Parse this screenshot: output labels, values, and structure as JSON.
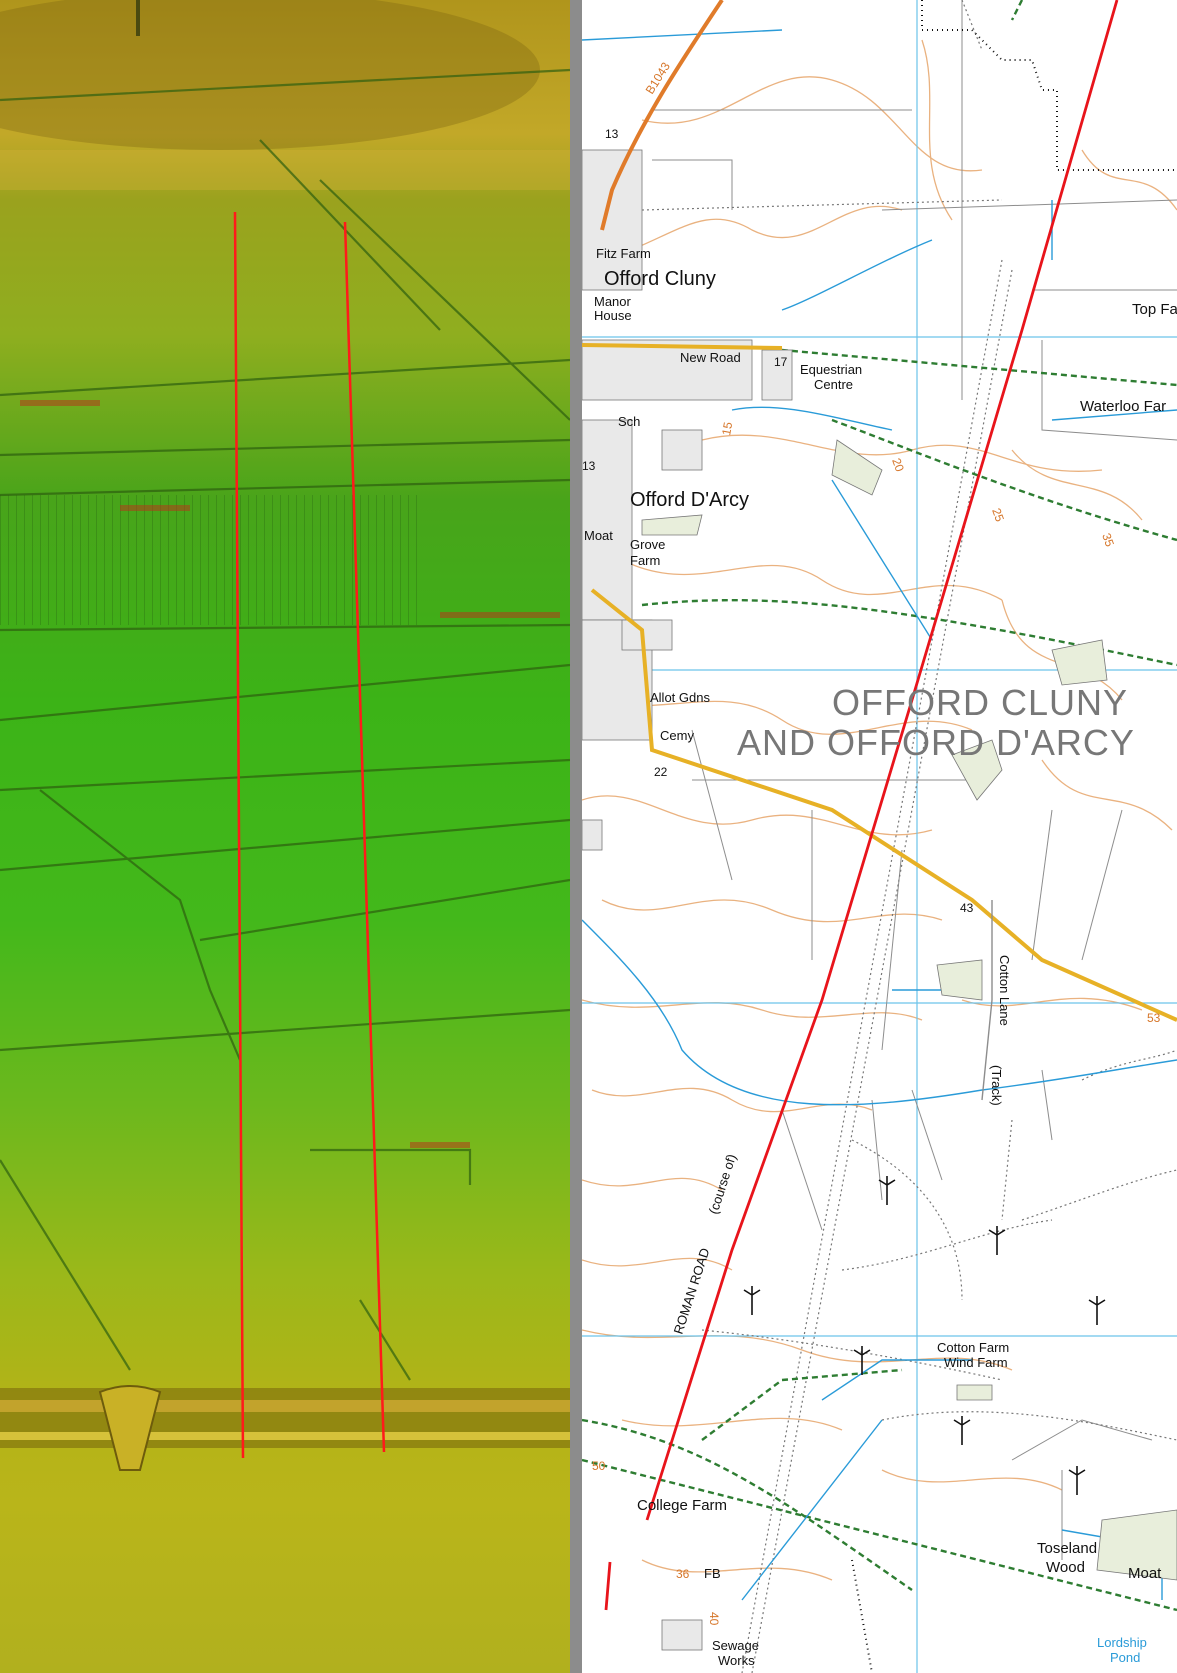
{
  "lidar_panel": {
    "colors": {
      "top": "#b39a1e",
      "mid": "#3fb21c",
      "bottom": "#b9b418",
      "trace": "#ff1a1a"
    }
  },
  "os_map": {
    "colors": {
      "grid": "#6cc3ea",
      "contour": "#e6a56a",
      "road_b": "#e07b2a",
      "road_minor": "#e7b126",
      "footpath": "#2e7d32",
      "field": "#8d8d8d",
      "trace": "#e8141b",
      "water": "#2a9bd8"
    },
    "road_number": "B1043",
    "places": {
      "offord_cluny": "Offord Cluny",
      "offord_darcy": "Offord D'Arcy",
      "parish_line1": "OFFORD CLUNY",
      "parish_line2": "AND OFFORD D'ARCY"
    },
    "labels": {
      "fitz_farm": "Fitz Farm",
      "manor": "Manor",
      "house": "House",
      "new_road": "New Road",
      "equestrian": "Equestrian",
      "centre": "Centre",
      "top_farm": "Top Fa",
      "waterloo": "Waterloo Far",
      "sch": "Sch",
      "moat_left": "Moat",
      "grove": "Grove",
      "farm": "Farm",
      "allot_gdns": "Allot Gdns",
      "cemy": "Cemy",
      "cotton_lane": "Cotton Lane",
      "track": "(Track)",
      "roman_road": "ROMAN ROAD",
      "course_of": "(course of)",
      "cotton_farm": "Cotton Farm",
      "wind_farm": "Wind Farm",
      "college_farm": "College Farm",
      "fb": "FB",
      "sewage": "Sewage",
      "works": "Works",
      "toseland": "Toseland",
      "wood": "Wood",
      "moat_right": "Moat",
      "lordship": "Lordship",
      "pond": "Pond"
    },
    "numbers": {
      "n13_top": "13",
      "n17": "17",
      "n13_side": "13",
      "n22": "22",
      "n43": "43",
      "c15": "15",
      "c20": "20",
      "c25": "25",
      "c35": "35",
      "c53": "53",
      "c50": "50",
      "c36": "36",
      "c40": "40"
    }
  }
}
